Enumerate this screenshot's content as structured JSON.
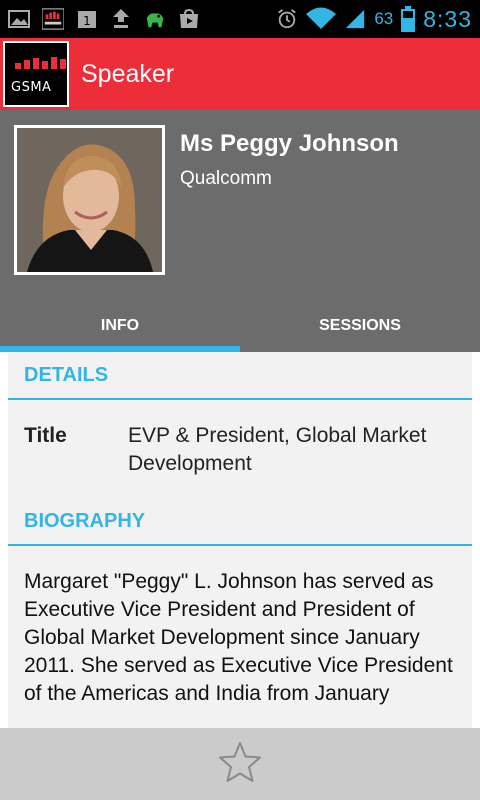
{
  "status_bar": {
    "battery": "63",
    "time": "8:33",
    "icons": [
      "gallery-icon",
      "gsma-notification-icon",
      "calendar-icon",
      "upload-icon",
      "android-icon",
      "play-store-icon",
      "alarm-icon",
      "wifi-icon",
      "signal-icon",
      "battery-icon"
    ]
  },
  "action_bar": {
    "logo_text": "GSMA",
    "title": "Speaker"
  },
  "speaker": {
    "name": "Ms Peggy Johnson",
    "company": "Qualcomm"
  },
  "tabs": [
    {
      "label": "INFO",
      "active": true
    },
    {
      "label": "SESSIONS",
      "active": false
    }
  ],
  "details": {
    "heading": "DETAILS",
    "title_label": "Title",
    "title_value": "EVP & President, Global Market Development"
  },
  "biography": {
    "heading": "BIOGRAPHY",
    "text": "Margaret \"Peggy\" L. Johnson has served as Executive Vice President and President of Global Market Development since January 2011. She served as Executive Vice President of the Americas and India from January"
  },
  "bottom_bar": {
    "favorite_icon": "star-outline-icon"
  },
  "colors": {
    "brand_red": "#ee2d3a",
    "accent_blue": "#33b5e5",
    "header_gray": "#6c6c6c"
  }
}
